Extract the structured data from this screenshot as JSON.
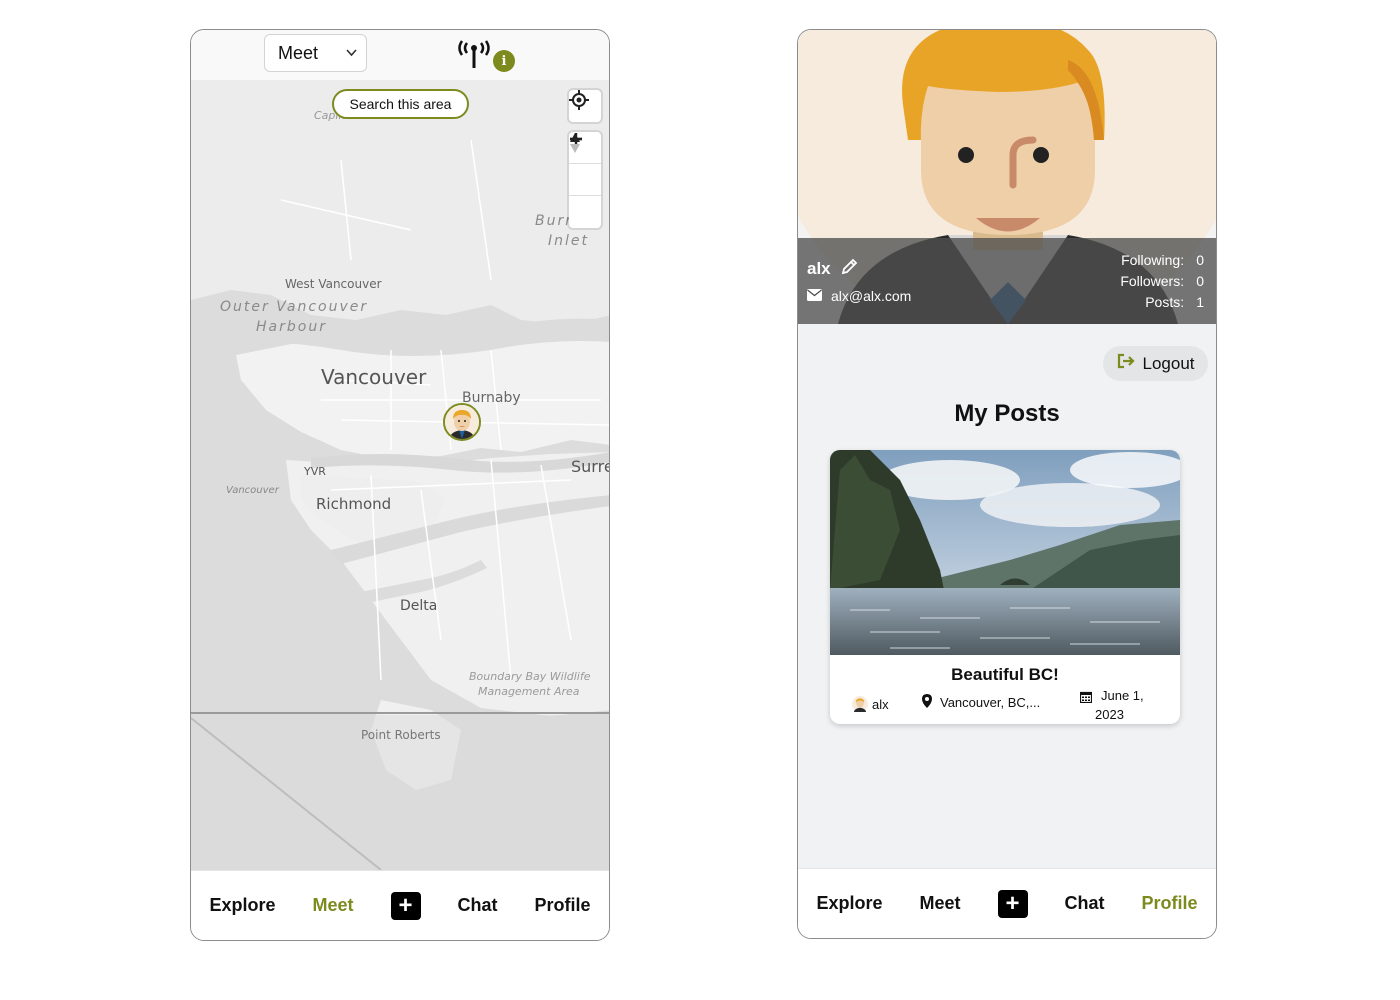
{
  "meet": {
    "mode_select": "Meet",
    "search_area": "Search this area",
    "info_badge": "i",
    "map_labels": {
      "capilano": "Capilano Pacific Trail",
      "west_vancouver": "West Vancouver",
      "outer_harbour_1": "Outer Vancouver",
      "outer_harbour_2": "Harbour",
      "burrard_1": "Burrard",
      "burrard_2": "Inlet",
      "vancouver": "Vancouver",
      "burnaby": "Burnaby",
      "surrey": "Surrey",
      "yvr": "YVR",
      "vancouver_intl": "Vancouver",
      "richmond": "Richmond",
      "delta": "Delta",
      "boundary_bay_1": "Boundary Bay Wildlife",
      "boundary_bay_2": "Management Area",
      "point_roberts": "Point Roberts"
    },
    "nav": {
      "explore": "Explore",
      "meet": "Meet",
      "plus": "+",
      "chat": "Chat",
      "profile": "Profile",
      "active": "meet"
    }
  },
  "profile": {
    "username": "alx",
    "email": "alx@alx.com",
    "stats": {
      "following_label": "Following:",
      "following": "0",
      "followers_label": "Followers:",
      "followers": "0",
      "posts_label": "Posts:",
      "posts": "1"
    },
    "logout_label": "Logout",
    "section_title": "My Posts",
    "posts": [
      {
        "title": "Beautiful BC!",
        "author": "alx",
        "location": "Vancouver, BC,...",
        "date_line1": "June 1,",
        "date_line2": "2023"
      }
    ],
    "nav": {
      "explore": "Explore",
      "meet": "Meet",
      "plus": "+",
      "chat": "Chat",
      "profile": "Profile",
      "active": "profile"
    }
  },
  "colors": {
    "accent": "#7d8b1e",
    "map_land": "#f1f1f1",
    "map_water": "#dcdcdc",
    "overlay": "#505050"
  },
  "icons": [
    "signal-icon",
    "info-icon",
    "locate-icon",
    "zoom-in-icon",
    "zoom-out-icon",
    "compass-icon",
    "pencil-icon",
    "envelope-icon",
    "logout-icon",
    "map-pin-icon",
    "calendar-icon"
  ]
}
